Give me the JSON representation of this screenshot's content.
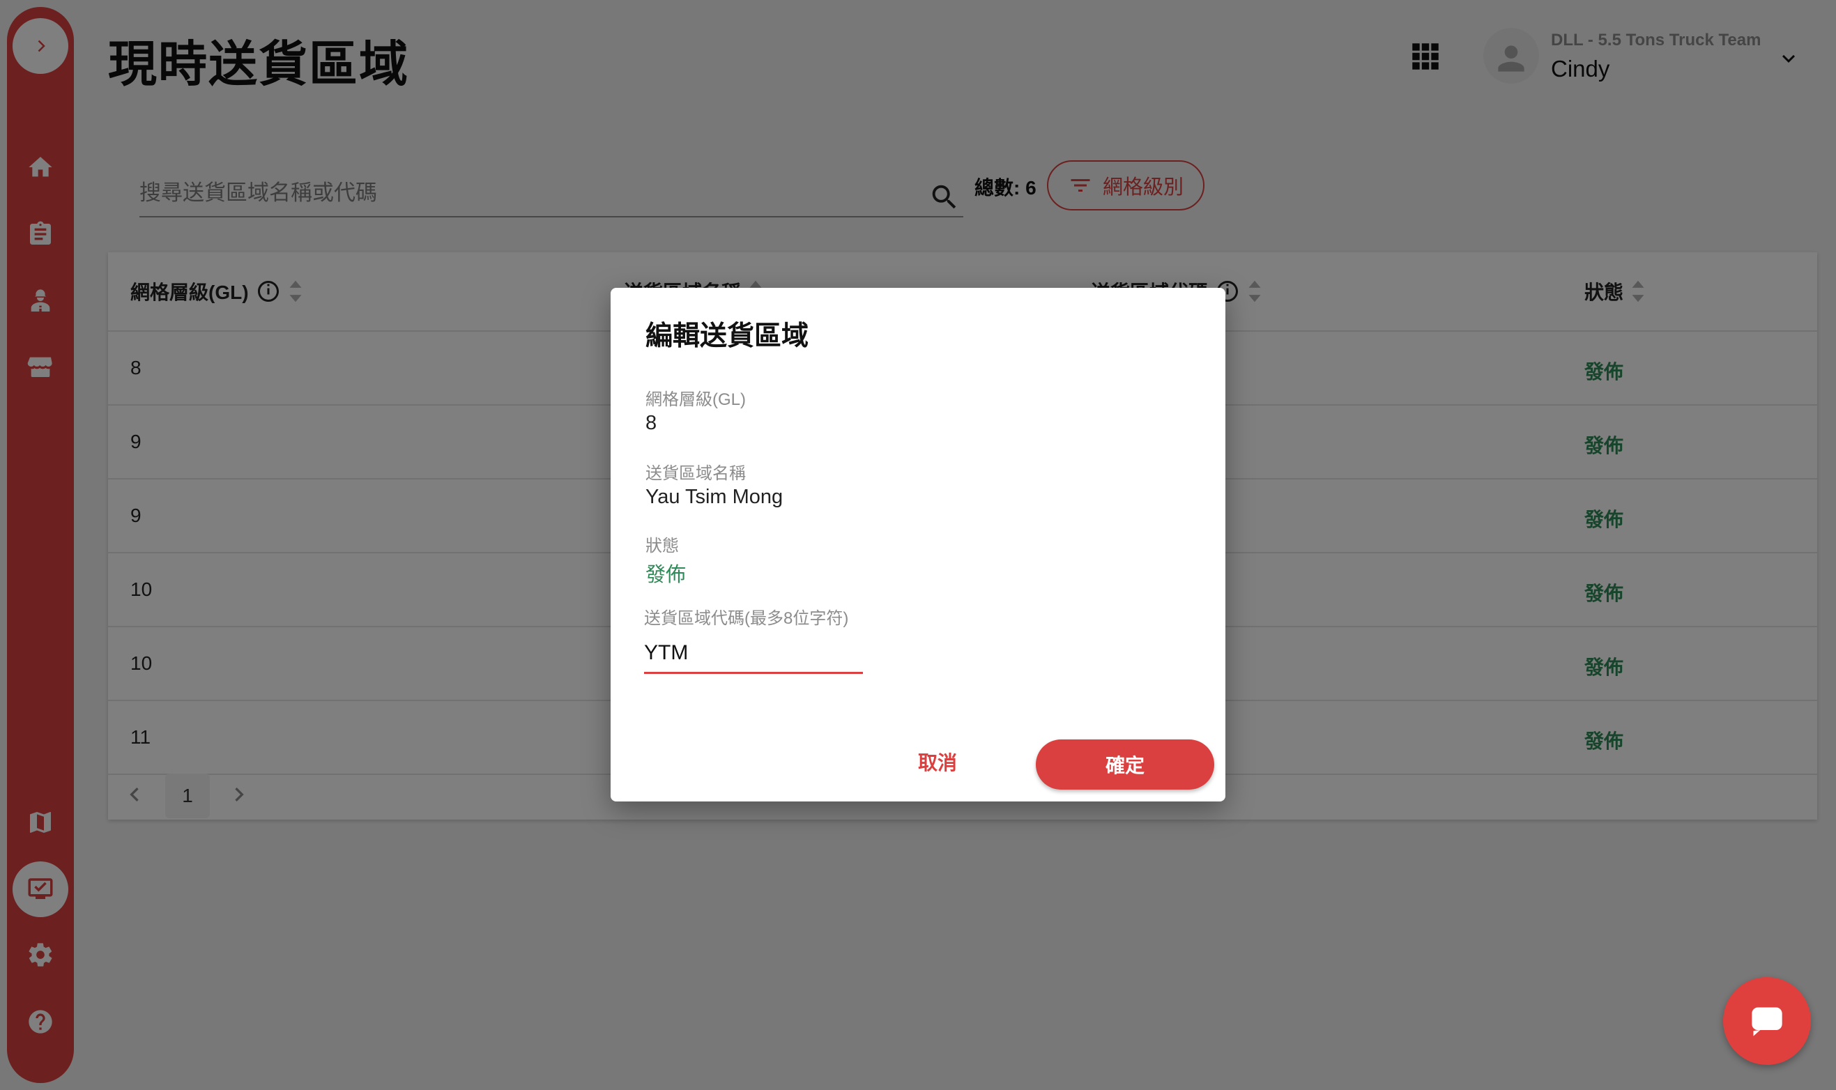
{
  "page": {
    "title": "現時送貨區域"
  },
  "user": {
    "team": "DLL - 5.5 Tons Truck Team",
    "name": "Cindy"
  },
  "search": {
    "placeholder": "搜尋送貨區域名稱或代碼"
  },
  "summary": {
    "total_label": "總數: 6"
  },
  "filter": {
    "label": "網格級別"
  },
  "table": {
    "columns": [
      "網格層級(GL)",
      "送貨區域名稱",
      "送貨區域代碼",
      "狀態"
    ],
    "rows": [
      {
        "gl": "8",
        "status": "發佈"
      },
      {
        "gl": "9",
        "status": "發佈"
      },
      {
        "gl": "9",
        "status": "發佈"
      },
      {
        "gl": "10",
        "status": "發佈"
      },
      {
        "gl": "10",
        "status": "發佈"
      },
      {
        "gl": "11",
        "status": "發佈"
      }
    ]
  },
  "pagination": {
    "current_page": "1"
  },
  "dialog": {
    "title": "編輯送貨區域",
    "gl_label": "網格層級(GL)",
    "gl_value": "8",
    "name_label": "送貨區域名稱",
    "name_value": "Yau Tsim Mong",
    "status_label": "狀態",
    "status_value": "發佈",
    "code_label": "送貨區域代碼(最多8位字符)",
    "code_value": "YTM",
    "cancel_label": "取消",
    "confirm_label": "確定"
  },
  "icons": {
    "sidebar": [
      "chevron-right-icon",
      "home-icon",
      "clipboard-icon",
      "driver-icon",
      "store-icon",
      "map-icon",
      "delivery-area-icon",
      "settings-icon",
      "help-icon"
    ],
    "header": [
      "apps-grid-icon",
      "user-avatar-icon",
      "chevron-down-icon"
    ],
    "chat": "chat-bubble-icon"
  },
  "colors": {
    "brand": "#d9403f",
    "published": "#2e8b57",
    "overlay": "rgba(0,0,0,0.5)"
  }
}
